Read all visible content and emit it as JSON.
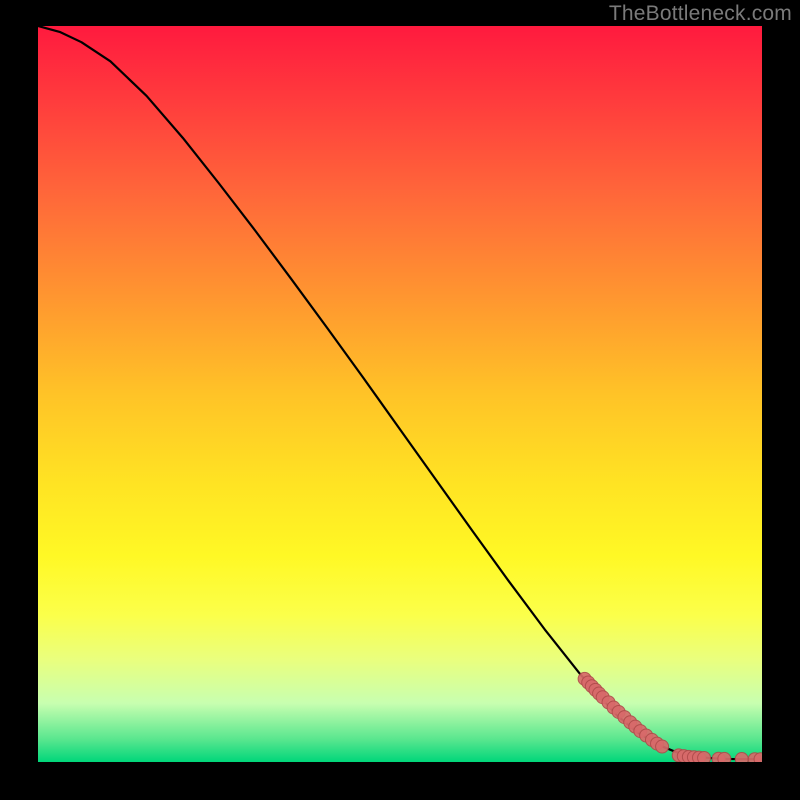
{
  "watermark": "TheBottleneck.com",
  "colors": {
    "background": "#000000",
    "curve": "#000000",
    "marker_fill": "#d86a6a",
    "marker_stroke": "#b04b4b",
    "watermark": "#7a7a7a"
  },
  "chart_data": {
    "type": "line",
    "title": "",
    "xlabel": "",
    "ylabel": "",
    "xlim": [
      0,
      100
    ],
    "ylim": [
      0,
      100
    ],
    "grid": false,
    "legend": false,
    "series": [
      {
        "name": "curve",
        "kind": "line",
        "x": [
          0,
          3,
          6,
          10,
          15,
          20,
          25,
          30,
          35,
          40,
          45,
          50,
          55,
          60,
          65,
          70,
          75,
          80,
          83,
          86,
          88,
          90,
          92,
          94,
          96,
          98,
          100
        ],
        "y": [
          100,
          99.2,
          97.8,
          95.2,
          90.5,
          84.8,
          78.6,
          72.2,
          65.6,
          58.9,
          52.1,
          45.2,
          38.3,
          31.4,
          24.6,
          18.0,
          11.8,
          6.3,
          3.9,
          2.2,
          1.4,
          0.9,
          0.6,
          0.45,
          0.4,
          0.38,
          0.38
        ]
      },
      {
        "name": "markers-on-slope",
        "kind": "scatter",
        "x": [
          75.5,
          76.0,
          76.5,
          77.0,
          77.5,
          78.0,
          78.8,
          79.5,
          80.2,
          81.0,
          81.8,
          82.5,
          83.2,
          84.0,
          84.8,
          85.5,
          86.2
        ],
        "y": [
          11.3,
          10.8,
          10.3,
          9.8,
          9.3,
          8.8,
          8.1,
          7.4,
          6.8,
          6.1,
          5.4,
          4.8,
          4.2,
          3.6,
          3.0,
          2.5,
          2.1
        ]
      },
      {
        "name": "markers-bottom",
        "kind": "scatter",
        "x": [
          88.5,
          89.2,
          89.9,
          90.6,
          91.3,
          92.0,
          94.0,
          94.8,
          97.2,
          99.0,
          99.8
        ],
        "y": [
          0.9,
          0.8,
          0.7,
          0.65,
          0.6,
          0.55,
          0.45,
          0.42,
          0.4,
          0.38,
          0.38
        ]
      }
    ]
  }
}
